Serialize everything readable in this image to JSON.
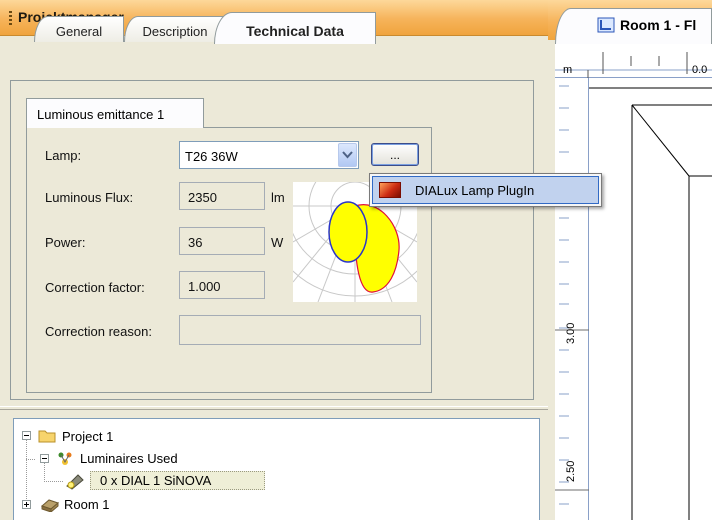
{
  "project_manager": {
    "title": "Projektmanager",
    "tabs": [
      "General",
      "Description",
      "Technical Data"
    ],
    "active_tab": "Technical Data"
  },
  "technical_data": {
    "subtab_label": "Luminous emittance 1",
    "lamp": {
      "label": "Lamp:",
      "value": "T26 36W",
      "browse_label": "..."
    },
    "luminous_flux": {
      "label": "Luminous Flux:",
      "value": "2350",
      "unit": "lm"
    },
    "power": {
      "label": "Power:",
      "value": "36",
      "unit": "W"
    },
    "correction_factor": {
      "label": "Correction factor:",
      "value": "1.000"
    },
    "correction_reason": {
      "label": "Correction reason:",
      "value": ""
    }
  },
  "popup_menu": {
    "items": [
      {
        "label": "DIALux Lamp PlugIn",
        "icon": "plugin-icon"
      }
    ]
  },
  "tree": {
    "items": [
      {
        "label": "Project 1",
        "icon": "folder-icon",
        "expanded": true
      },
      {
        "label": "Luminaires Used",
        "icon": "luminaires-icon",
        "expanded": true
      },
      {
        "label": "0 x DIAL 1 SiNOVA",
        "icon": "luminaire-icon"
      },
      {
        "label": "Room 1",
        "icon": "room-icon",
        "expanded": false
      }
    ]
  },
  "room_view": {
    "tab_label": "Room 1 - Fl",
    "ruler": {
      "unit": "m",
      "top_tick": "0.0",
      "left_ticks": [
        "3.00",
        "2.50"
      ]
    }
  },
  "colors": {
    "header_orange": "#f6b35a",
    "selection_blue": "#c1d2ee",
    "polar_yellow": "#ffff00",
    "polar_red": "#e0103a",
    "polar_blue": "#2a35c8"
  }
}
